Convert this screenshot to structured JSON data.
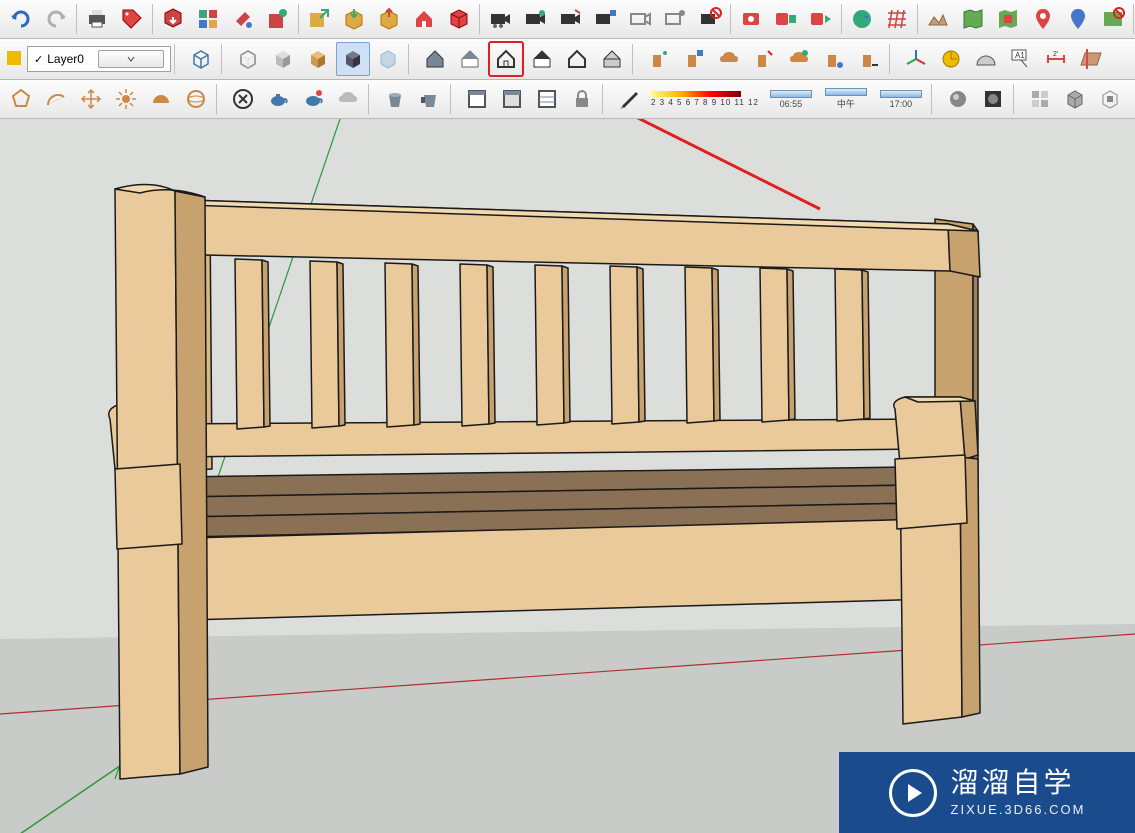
{
  "layer": {
    "current": "Layer0"
  },
  "spectrum": {
    "labels": "2 3 4 5 6 7 8 9 10 11 12"
  },
  "times": {
    "t1": "06:55",
    "t2": "中午",
    "t3": "17:00"
  },
  "watermark": {
    "cn": "溜溜自学",
    "en": "ZIXUE.3D66.COM"
  },
  "icons": {
    "undo": "undo",
    "redo": "redo",
    "print": "print",
    "tag": "tag",
    "dl": "download-model",
    "components": "components",
    "paint": "paint-bucket",
    "ext": "extension",
    "export": "export",
    "box-out": "box-out",
    "box-in": "box-in",
    "home-red": "home-red",
    "comp2": "component-red",
    "cam": "camera",
    "cam2": "camera-2",
    "cam3": "camera-3",
    "cam4": "camera-4",
    "cam5": "camera-5",
    "cam6": "camera-6",
    "nocam": "no-camera",
    "record": "record",
    "record2": "record-comp",
    "record3": "record-play",
    "globe": "earth",
    "grid": "grid",
    "terrain": "terrain",
    "map": "map",
    "geo": "geo-model",
    "pin": "placemark",
    "marker": "marker",
    "nomap": "no-map",
    "cube": "cube",
    "check": "checkbox",
    "wire": "style-wireframe",
    "hidden": "style-hidden",
    "shaded": "style-shaded",
    "shaded-tex": "style-shaded-texture",
    "mono": "style-mono",
    "xray": "style-xray",
    "dh1": "dynhouse-fill",
    "dh2": "dynhouse-blue",
    "dh3": "dynhouse-line-hl",
    "dh4": "dynhouse-flat",
    "dh5": "dynhouse-outline",
    "dh6": "dynhouse-roof",
    "spray1": "spray-1",
    "spray2": "spray-2",
    "cloud1": "cloud-1",
    "spray3": "spray-3",
    "cloud2": "cloud-2",
    "spray4": "spray-4",
    "spray5": "spray-5",
    "axes": "axes-tool",
    "tape": "tape-measure",
    "prot": "protractor",
    "text": "text-tool",
    "dim": "dimension",
    "section": "section-plane",
    "poly": "polygon",
    "pie": "arc",
    "hand": "pan",
    "sun": "sun",
    "half": "half-dome",
    "sphere": "sphere",
    "vr1": "vray-1",
    "vr2": "vray-teapot",
    "vr3": "vray-teapot-rt",
    "vr4": "vray-cloud",
    "win1": "window-1",
    "win2": "window-2",
    "win3": "window-3",
    "win4": "window-4",
    "lock": "lock",
    "brush": "brush",
    "san1": "sandbox-1",
    "san2": "sandbox-2",
    "san3": "sandbox-3",
    "san4": "sandbox-4",
    "san5": "sandbox-5",
    "cup1": "cup-1",
    "cup2": "cup-2"
  }
}
